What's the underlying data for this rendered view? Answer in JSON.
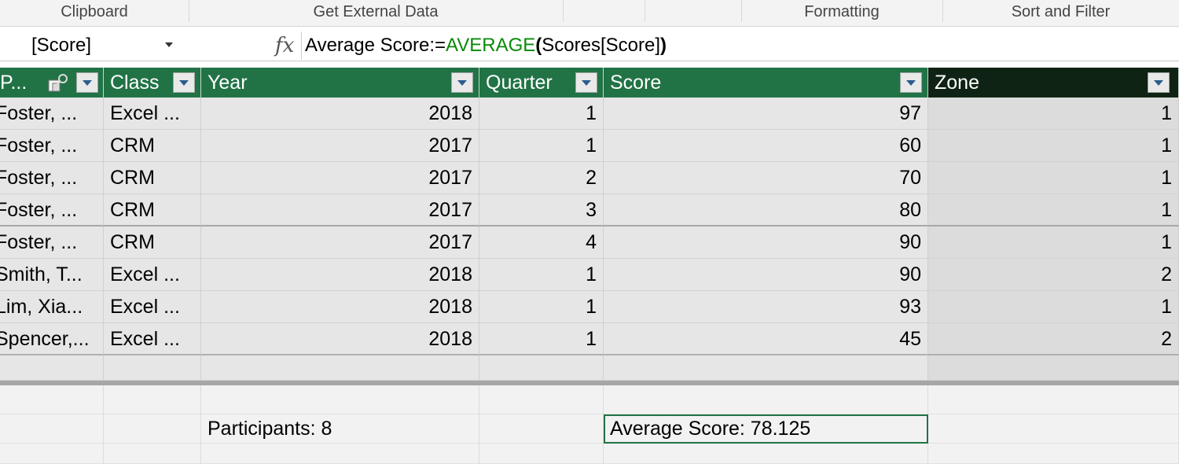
{
  "ribbon": {
    "groups": [
      "Clipboard",
      "Get External Data",
      "Formatting",
      "Sort and Filter"
    ]
  },
  "formula_bar": {
    "name_box": "[Score]",
    "fx_symbol": "fx",
    "formula_prefix": "Average Score:=",
    "formula_function": "AVERAGE",
    "formula_open": "(",
    "formula_arg": "Scores[Score]",
    "formula_close": ")"
  },
  "table": {
    "columns": [
      "P...",
      "Class",
      "Year",
      "Quarter",
      "Score",
      "Zone"
    ],
    "rows": [
      [
        "Foster, ...",
        "Excel ...",
        "2018",
        "1",
        "97",
        "1"
      ],
      [
        "Foster, ...",
        "CRM",
        "2017",
        "1",
        "60",
        "1"
      ],
      [
        "Foster, ...",
        "CRM",
        "2017",
        "2",
        "70",
        "1"
      ],
      [
        "Foster, ...",
        "CRM",
        "2017",
        "3",
        "80",
        "1"
      ],
      [
        "Foster, ...",
        "CRM",
        "2017",
        "4",
        "90",
        "1"
      ],
      [
        "Smith, T...",
        "Excel ...",
        "2018",
        "1",
        "90",
        "2"
      ],
      [
        "Lim, Xia...",
        "Excel ...",
        "2018",
        "1",
        "93",
        "1"
      ],
      [
        "Spencer,...",
        "Excel ...",
        "2018",
        "1",
        "45",
        "2"
      ]
    ]
  },
  "calculation_area": {
    "participants_label": "Participants: 8",
    "average_label": "Average Score: 78.125"
  },
  "colors": {
    "header_green": "#217346",
    "selected_header": "#0f2314",
    "function_green": "#0a8a0a"
  }
}
